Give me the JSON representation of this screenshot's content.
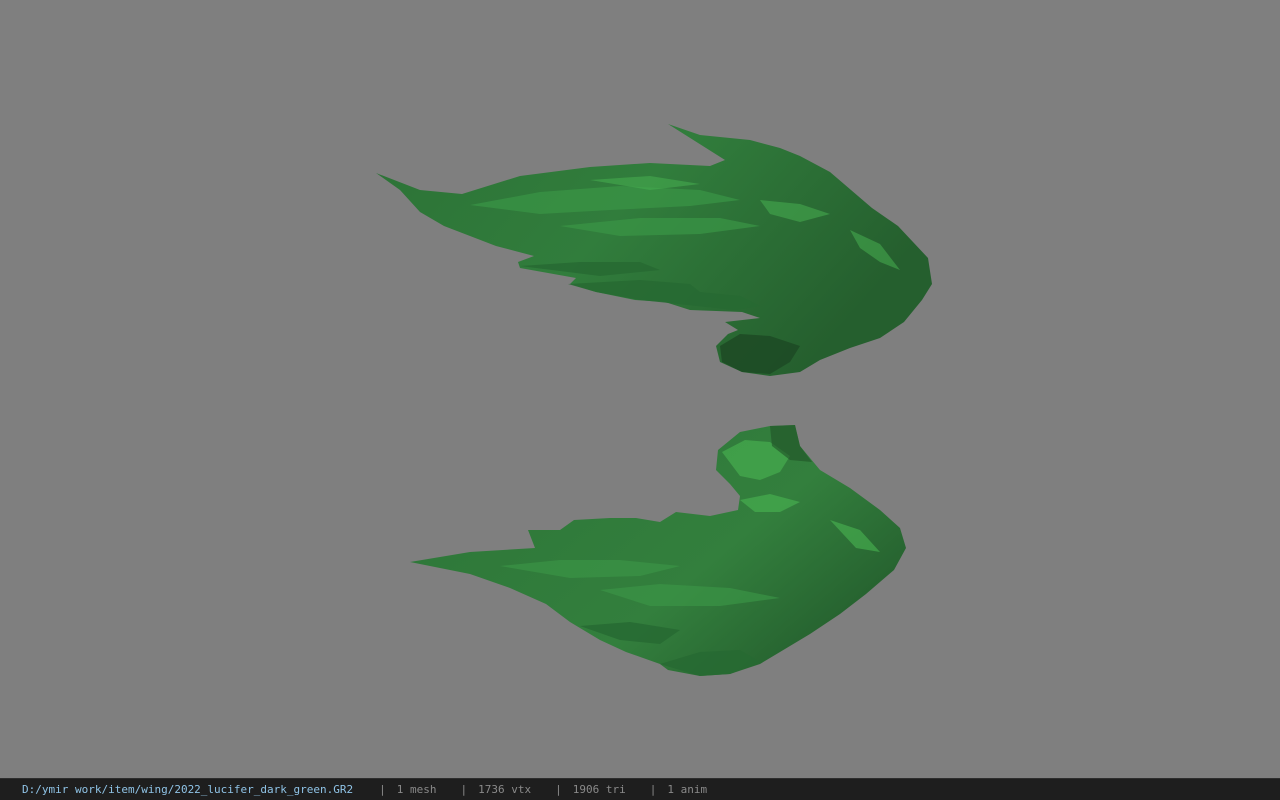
{
  "viewport": {
    "background_color": "#7f7f7f",
    "model": {
      "name": "green-feather-wings",
      "colors": {
        "dark": "#1e4f25",
        "mid": "#2f7a3a",
        "light": "#3f9a4a",
        "highlight": "#48b34f"
      }
    }
  },
  "status_bar": {
    "file_path": "D:/ymir work/item/wing/2022_lucifer_dark_green.GR2",
    "separator": "|",
    "mesh_count": "1 mesh",
    "vertex_count": "1736 vtx",
    "triangle_count": "1906 tri",
    "anim_count": "1 anim"
  }
}
